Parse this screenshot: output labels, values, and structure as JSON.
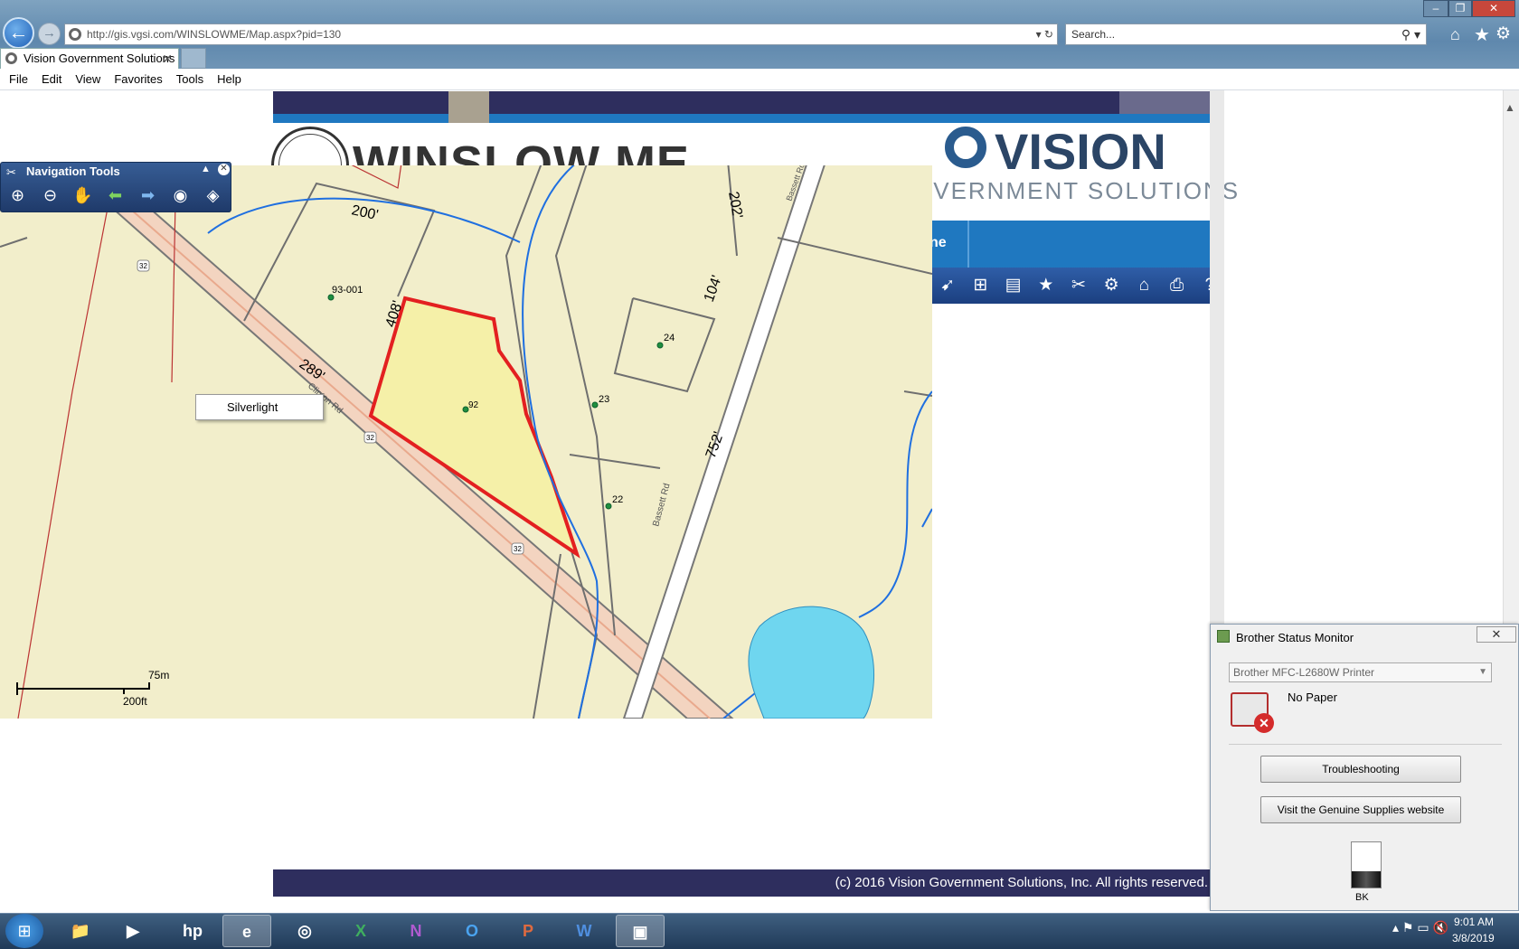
{
  "browser": {
    "url": "http://gis.vgsi.com/WINSLOWME/Map.aspx?pid=130",
    "search_placeholder": "Search...",
    "tab_title": "Vision Government Solutions",
    "tab_close": "✕",
    "back": "←",
    "forward": "→",
    "win_min": "–",
    "win_max": "❐",
    "win_close": "✕"
  },
  "menu": [
    "File",
    "Edit",
    "View",
    "Favorites",
    "Tools",
    "Help"
  ],
  "site": {
    "town_title": "WINSLOW ME",
    "logo_text": "VISION",
    "logo_sub": "OVERNMENT SOLUTIONS",
    "menu_fragment": "ne",
    "copyright": "(c) 2016 Vision Government Solutions, Inc. All rights reserved."
  },
  "nav_tools": {
    "title": "Navigation Tools",
    "icons": [
      "zoom-in-icon",
      "zoom-out-icon",
      "pan-hand-icon",
      "back-arrow-icon",
      "forward-arrow-icon",
      "full-extent-globe-icon",
      "layers-icon"
    ]
  },
  "context_menu": {
    "label": "Silverlight"
  },
  "map": {
    "scale_m": "75m",
    "scale_ft": "200ft",
    "parcel_labels": [
      "93-001",
      "92",
      "24",
      "23",
      "22"
    ],
    "dimension_labels": [
      "200'",
      "408'",
      "289'",
      "202'",
      "104'",
      "752'"
    ],
    "road_labels": [
      "Clinton Rd",
      "Bassett Rd",
      "Bassett Rd"
    ],
    "shields": [
      "32",
      "32",
      "32"
    ],
    "colors": {
      "parcel_fill": "#f2eecb",
      "selected_fill": "#f5f0a8",
      "selected_stroke": "#e32020",
      "road": "#f3c9b8",
      "water": "#6fd6ef",
      "stream": "#1f6fe0",
      "line": "#6f6f6f"
    }
  },
  "status_monitor": {
    "title": "Brother Status Monitor",
    "close": "✕",
    "printer": "Brother MFC-L2680W Printer",
    "status": "No Paper",
    "btn_troubleshoot": "Troubleshooting",
    "btn_supplies": "Visit the Genuine Supplies website",
    "ink_label": "BK"
  },
  "taskbar": {
    "time": "9:01 AM",
    "date": "3/8/2019",
    "items": [
      "file-explorer-icon",
      "media-player-icon",
      "hp-icon",
      "internet-explorer-icon",
      "chrome-icon",
      "excel-icon",
      "onenote-icon",
      "outlook-icon",
      "powerpoint-icon",
      "word-icon",
      "brother-monitor-icon"
    ]
  }
}
